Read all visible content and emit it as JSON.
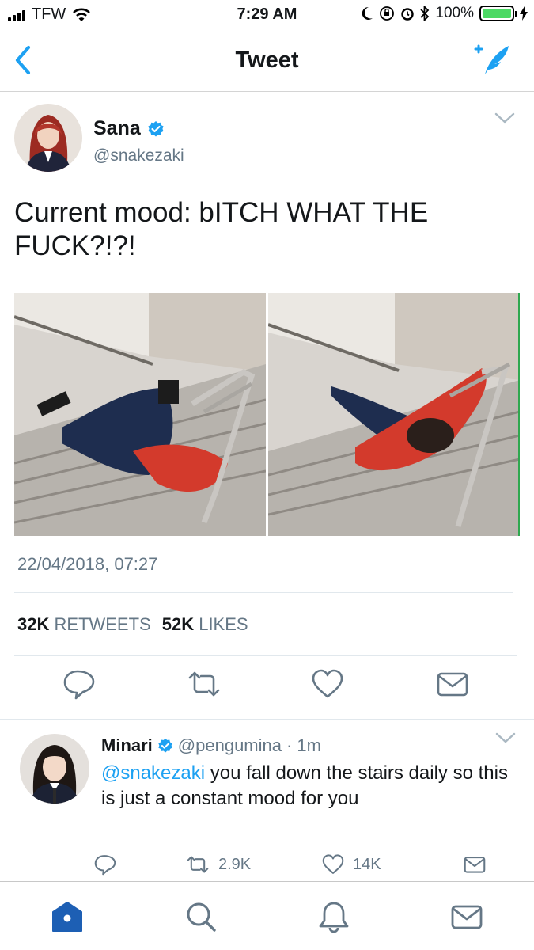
{
  "status_bar": {
    "carrier": "TFW",
    "time": "7:29 AM",
    "battery": "100%"
  },
  "nav": {
    "title": "Tweet",
    "back_icon": "chevron-left-icon",
    "compose_icon": "compose-tweet-icon"
  },
  "tweet": {
    "author_name": "Sana",
    "author_handle": "@snakezaki",
    "verified": true,
    "text": "Current mood: bITCH WHAT THE FUCK?!?!",
    "timestamp": "22/04/2018, 07:27",
    "retweets_count": "32K",
    "retweets_label": "RETWEETS",
    "likes_count": "52K",
    "likes_label": "LIKES",
    "actions": [
      "reply-icon",
      "retweet-icon",
      "heart-icon",
      "message-icon"
    ]
  },
  "reply": {
    "author_name": "Minari",
    "author_handle": "@pengumina",
    "separator": "·",
    "time": "1m",
    "mention": "@snakezaki",
    "text": " you fall down the stairs daily so this is just a constant mood for you",
    "retweets": "2.9K",
    "likes": "14K"
  },
  "tab_bar": {
    "items": [
      "home-icon",
      "search-icon",
      "notifications-icon",
      "messages-icon"
    ],
    "active": "home-icon"
  },
  "colors": {
    "accent": "#1da1f2",
    "tab_active": "#1d5fb4",
    "secondary_text": "#657786",
    "battery": "#4cd964"
  }
}
